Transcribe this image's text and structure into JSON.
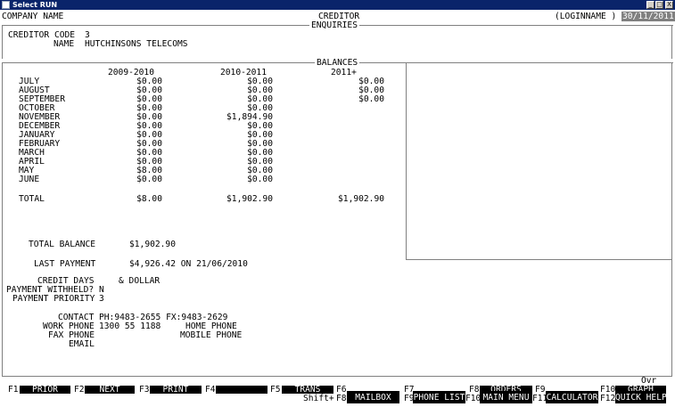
{
  "window": {
    "title": "Select RUN",
    "minimize": "_",
    "maximize": "□",
    "close": "X"
  },
  "header": {
    "company": "COMPANY NAME",
    "title": "CREDITOR",
    "subtitle": "ENQUIRIES",
    "login": "(LOGINNAME )",
    "date": "30/11/2011"
  },
  "creditor": {
    "code_label": "CREDITOR CODE",
    "code": "3",
    "name_label": "NAME",
    "name": "HUTCHINSONS TELECOMS"
  },
  "balances": {
    "section_label": "BALANCES",
    "col1_header": "2009-2010",
    "col2_header": "2010-2011",
    "col3_header": "2011+",
    "months": [
      "JULY",
      "AUGUST",
      "SEPTEMBER",
      "OCTOBER",
      "NOVEMBER",
      "DECEMBER",
      "JANUARY",
      "FEBRUARY",
      "MARCH",
      "APRIL",
      "MAY",
      "JUNE"
    ],
    "col1": [
      "$0.00",
      "$0.00",
      "$0.00",
      "$0.00",
      "$0.00",
      "$0.00",
      "$0.00",
      "$0.00",
      "$0.00",
      "$0.00",
      "$8.00",
      "$0.00"
    ],
    "col2": [
      "$0.00",
      "$0.00",
      "$0.00",
      "$0.00",
      "$1,894.90",
      "$0.00",
      "$0.00",
      "$0.00",
      "$0.00",
      "$0.00",
      "$0.00",
      "$0.00"
    ],
    "col3": [
      "$0.00",
      "$0.00",
      "$0.00"
    ],
    "total_label": "TOTAL",
    "total1": "$8.00",
    "total2": "$1,902.90",
    "total3": "$1,902.90"
  },
  "summary": {
    "total_balance_label": "TOTAL BALANCE",
    "total_balance": "$1,902.90",
    "last_payment_label": "LAST PAYMENT",
    "last_payment": "$4,926.42 ON 21/06/2010",
    "credit_days_label": "CREDIT DAYS",
    "dollar_label": "& DOLLAR",
    "payment_withheld_label": "PAYMENT WITHHELD?",
    "payment_withheld": "N",
    "payment_priority_label": "PAYMENT PRIORITY",
    "payment_priority": "3"
  },
  "contact": {
    "contact_label": "CONTACT",
    "contact": "PH:9483-2655 FX:9483-2629",
    "work_phone_label": "WORK PHONE",
    "work_phone": "1300 55 1188",
    "home_phone_label": "HOME PHONE",
    "fax_phone_label": "FAX PHONE",
    "mobile_phone_label": "MOBILE PHONE",
    "email_label": "EMAIL"
  },
  "status": {
    "ovr": "Ovr"
  },
  "fkeys": {
    "f1": "F1",
    "f1_label": "PRIOR",
    "f2": "F2",
    "f2_label": "NEXT",
    "f3": "F3",
    "f3_label": "PRINT",
    "f4": "F4",
    "f4_label": "",
    "f5": "F5",
    "f5_label": "TRANS",
    "f6": "F6",
    "f6_label": "",
    "f7": "F7",
    "f7_label": "",
    "f8": "F8",
    "f8_label": "ORDERS",
    "f9": "F9",
    "f9_label": "",
    "f10": "F10",
    "f10_label": "GRAPH",
    "shift": "Shift+",
    "sf8": "F8",
    "sf8_label": "MAILBOX",
    "sf9": "F9",
    "sf9_label": "PHONE LIST",
    "sf10": "F10",
    "sf10_label": "MAIN MENU",
    "sf11": "F11",
    "sf11_label": "CALCULATOR",
    "sf12": "F12",
    "sf12_label": "QUICK HELP"
  }
}
